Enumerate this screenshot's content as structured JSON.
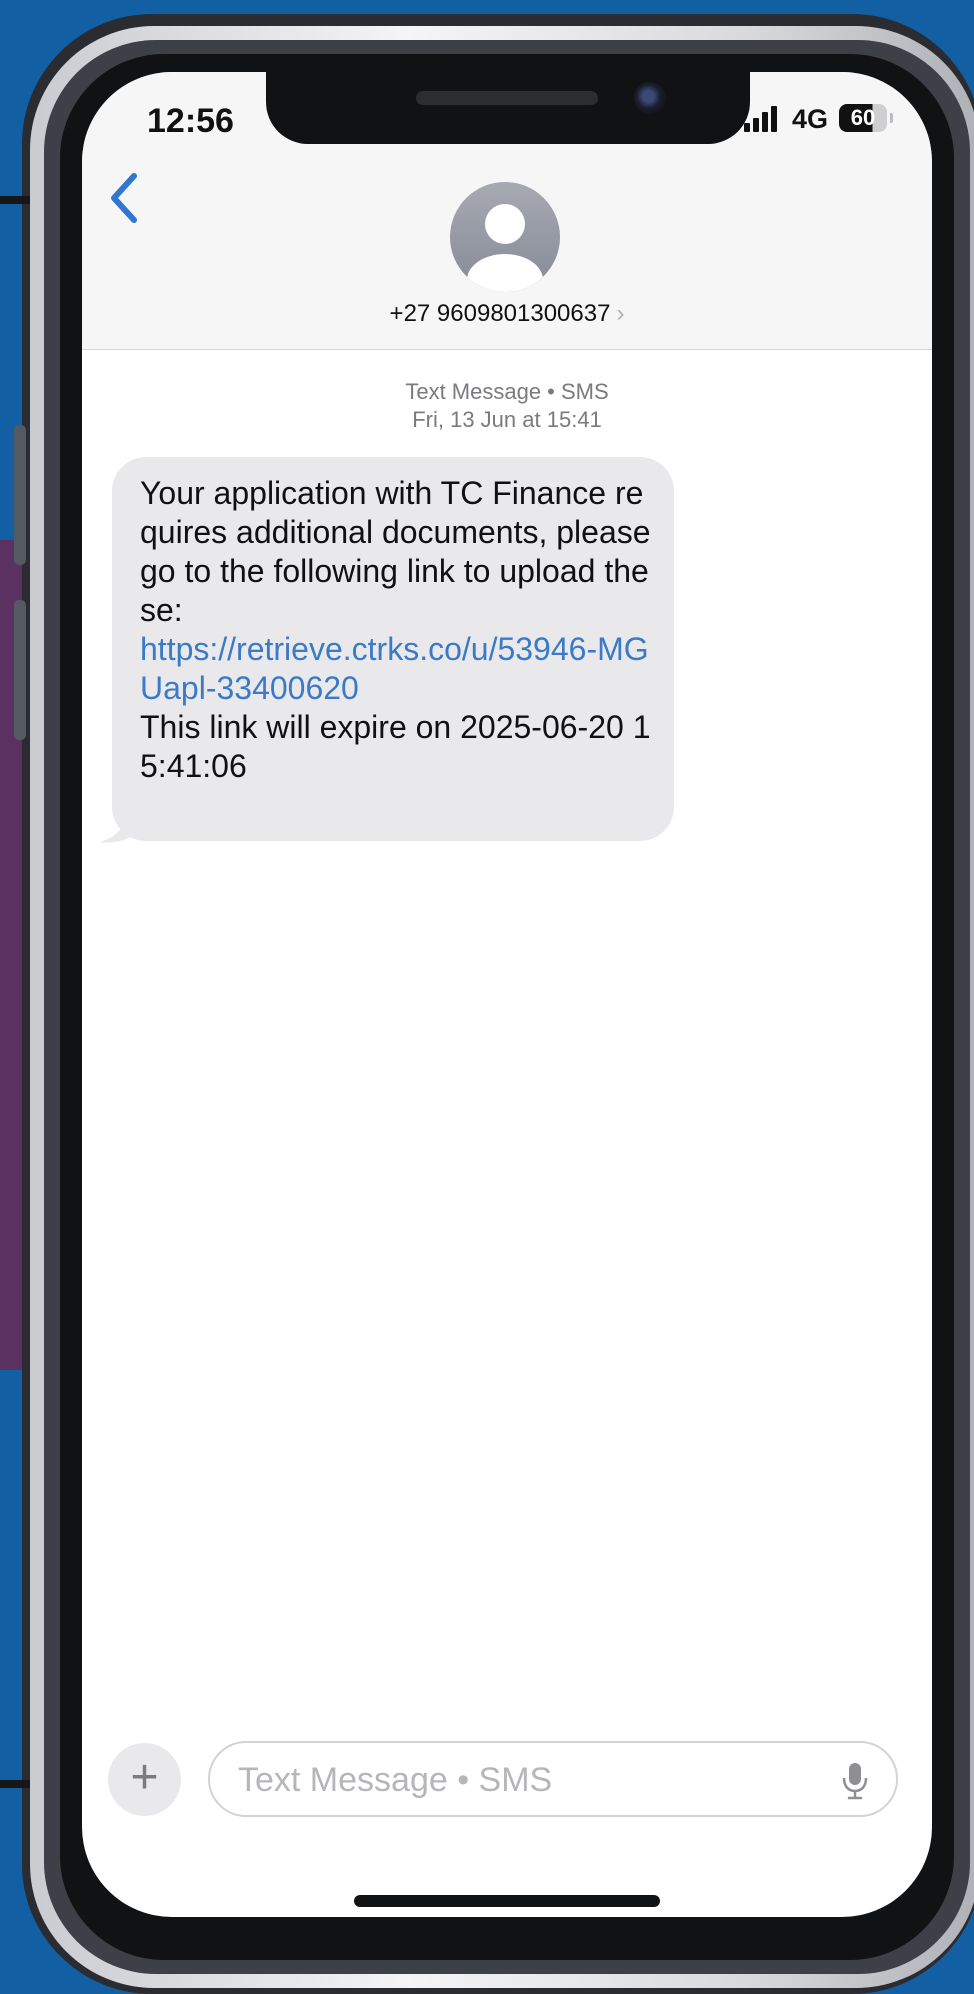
{
  "status_bar": {
    "time": "12:56",
    "network": "4G",
    "battery": "60"
  },
  "header": {
    "contact_number": "+27 9609801300637",
    "chevron": "›"
  },
  "thread": {
    "service_label": "Text Message • SMS",
    "date_label": "Fri, 13 Jun at 15:41",
    "message": {
      "text_before": "Your application with TC Finance requires additional documents, please go to the following link to upload these:",
      "link": "https://retrieve.ctrks.co/u/53946-MGUapl-33400620",
      "text_after": "This link will expire on 2025-06-20 15:41:06"
    }
  },
  "compose": {
    "plus_label": "+",
    "placeholder": "Text Message • SMS"
  },
  "icons": {
    "back": "chevron-left-icon",
    "avatar": "person-icon",
    "mic": "microphone-icon",
    "signal": "signal-bars-icon"
  },
  "colors": {
    "accent": "#2f77d1",
    "link": "#3a7ac6",
    "bubble": "#e9e9eb",
    "background": "#135fa3"
  }
}
